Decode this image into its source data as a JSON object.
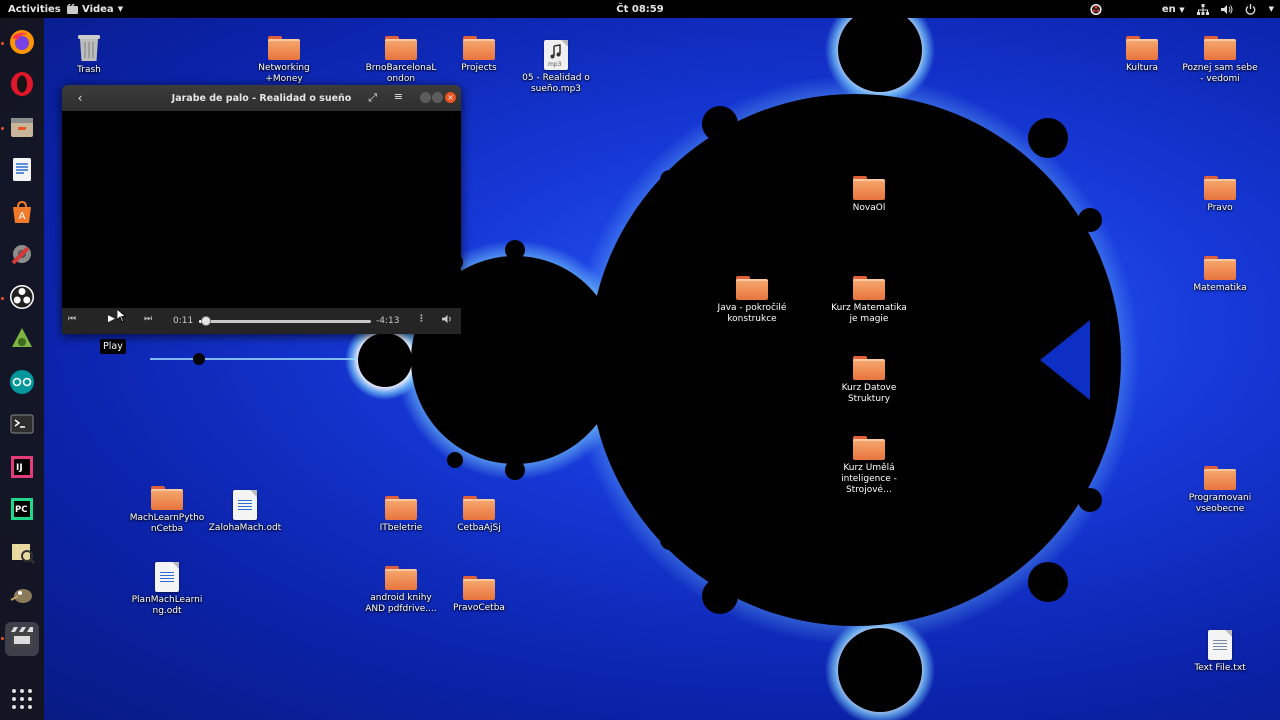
{
  "topbar": {
    "activities": "Activities",
    "app_menu": "Videa",
    "clock": "Čt 08:59",
    "language": "en"
  },
  "dock": {
    "items": [
      {
        "name": "firefox-icon",
        "color": "#ff7139"
      },
      {
        "name": "opera-icon",
        "color": "#e0162b"
      },
      {
        "name": "file-manager-icon",
        "color": "#c7a07a"
      },
      {
        "name": "writer-icon",
        "color": "#2a6fd0"
      },
      {
        "name": "software-center-icon",
        "color": "#f07a2a"
      },
      {
        "name": "settings-icon",
        "color": "#d83a3a"
      },
      {
        "name": "obs-icon",
        "color": "#2b2b2b"
      },
      {
        "name": "android-studio-icon",
        "color": "#7cb342"
      },
      {
        "name": "arduino-icon",
        "color": "#00979c"
      },
      {
        "name": "terminal-icon",
        "color": "#2d2d2d"
      },
      {
        "name": "intellij-icon",
        "color": "#e43b7a"
      },
      {
        "name": "pycharm-icon",
        "color": "#21d789"
      },
      {
        "name": "image-viewer-icon",
        "color": "#d9c27a"
      },
      {
        "name": "gimp-icon",
        "color": "#8a7a5a"
      },
      {
        "name": "videos-icon",
        "color": "#555555"
      }
    ]
  },
  "desktop": {
    "icons": [
      {
        "label": "Trash",
        "type": "trash"
      },
      {
        "label": "Networking +Money",
        "type": "folder"
      },
      {
        "label": "BrnoBarcelonaLondon",
        "type": "folder"
      },
      {
        "label": "Projects",
        "type": "folder"
      },
      {
        "label": "05 - Realidad o sueño.mp3",
        "type": "audio",
        "badge": "mp3"
      },
      {
        "label": "Kultura",
        "type": "folder"
      },
      {
        "label": "Poznej sam sebe - vedomi",
        "type": "folder"
      },
      {
        "label": "NovaOl",
        "type": "folder"
      },
      {
        "label": "Pravo",
        "type": "folder"
      },
      {
        "label": "Matematika",
        "type": "folder"
      },
      {
        "label": "Java - pokročilé konstrukce",
        "type": "folder"
      },
      {
        "label": "Kurz Matematika je magie",
        "type": "folder"
      },
      {
        "label": "Kurz Datove Struktury",
        "type": "folder"
      },
      {
        "label": "Kurz Umělá inteligence - Strojové…",
        "type": "folder"
      },
      {
        "label": "MachLearnPythonCetba",
        "type": "folder"
      },
      {
        "label": "ZalohaMach.odt",
        "type": "odt"
      },
      {
        "label": "ITbeletrie",
        "type": "folder"
      },
      {
        "label": "CetbaAjSj",
        "type": "folder"
      },
      {
        "label": "PlanMachLearning.odt",
        "type": "odt"
      },
      {
        "label": "android knihy AND pdfdrive....",
        "type": "folder"
      },
      {
        "label": "PravoCetba",
        "type": "folder"
      },
      {
        "label": "Programovani vseobecne",
        "type": "folder"
      },
      {
        "label": "Text File.txt",
        "type": "txt"
      }
    ]
  },
  "video_window": {
    "title": "Jarabe de palo - Realidad o sueño",
    "elapsed": "0:11",
    "remaining": "-4:13",
    "progress": 0.043,
    "tooltip": "Play"
  }
}
